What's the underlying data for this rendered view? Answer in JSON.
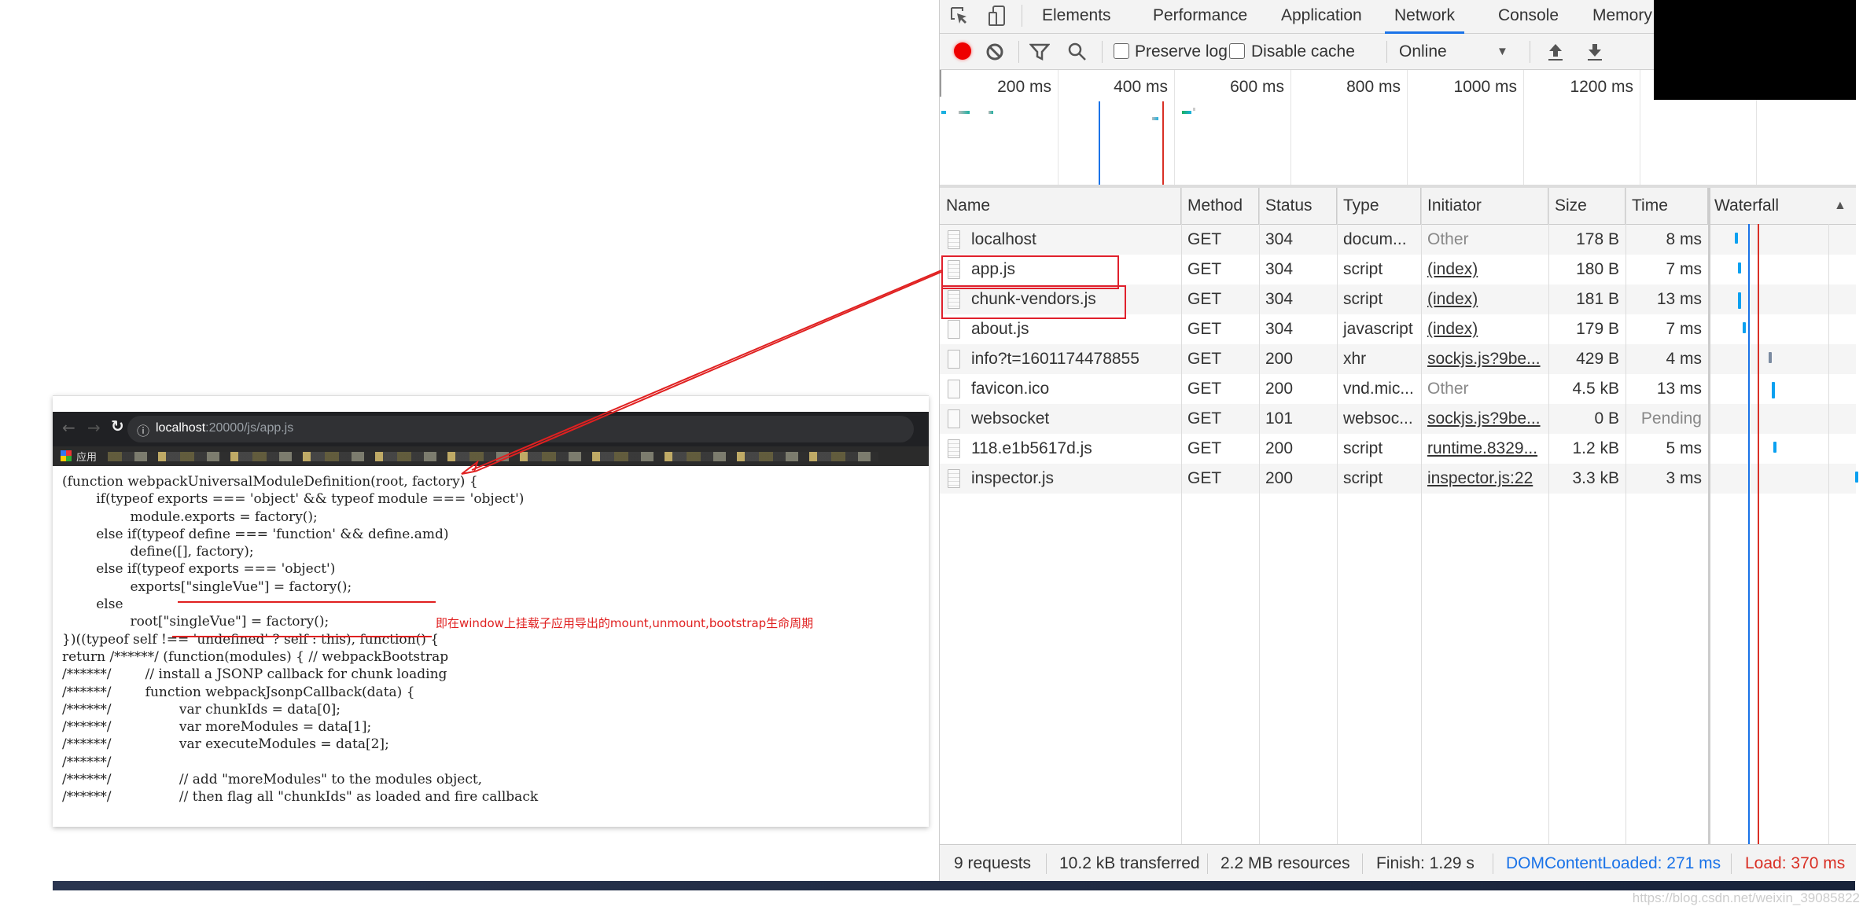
{
  "devtools": {
    "tabs": [
      "Elements",
      "Performance",
      "Application",
      "Network",
      "Console",
      "Memory"
    ],
    "active_tab": "Network",
    "toolbar": {
      "preserve_log": "Preserve log",
      "preserve_log_checked": false,
      "disable_cache": "Disable cache",
      "disable_cache_checked": false,
      "throttling": "Online"
    },
    "overview": {
      "ticks": [
        "200 ms",
        "400 ms",
        "600 ms",
        "800 ms",
        "1000 ms",
        "1200 ms"
      ],
      "domcontentloaded_ms": 271,
      "load_ms": 370
    },
    "table": {
      "headers": [
        "Name",
        "Method",
        "Status",
        "Type",
        "Initiator",
        "Size",
        "Time",
        "Waterfall"
      ],
      "rows": [
        {
          "name": "localhost",
          "method": "GET",
          "status": "304",
          "type": "docum...",
          "initiator": "Other",
          "size": "178 B",
          "time": "8 ms"
        },
        {
          "name": "app.js",
          "method": "GET",
          "status": "304",
          "type": "script",
          "initiator": "(index)",
          "size": "180 B",
          "time": "7 ms"
        },
        {
          "name": "chunk-vendors.js",
          "method": "GET",
          "status": "304",
          "type": "script",
          "initiator": "(index)",
          "size": "181 B",
          "time": "13 ms"
        },
        {
          "name": "about.js",
          "method": "GET",
          "status": "304",
          "type": "javascript",
          "initiator": "(index)",
          "size": "179 B",
          "time": "7 ms"
        },
        {
          "name": "info?t=1601174478855",
          "method": "GET",
          "status": "200",
          "type": "xhr",
          "initiator": "sockjs.js?9be...",
          "size": "429 B",
          "time": "4 ms"
        },
        {
          "name": "favicon.ico",
          "method": "GET",
          "status": "200",
          "type": "vnd.mic...",
          "initiator": "Other",
          "size": "4.5 kB",
          "time": "13 ms"
        },
        {
          "name": "websocket",
          "method": "GET",
          "status": "101",
          "type": "websoc...",
          "initiator": "sockjs.js?9be...",
          "size": "0 B",
          "time": "Pending"
        },
        {
          "name": "118.e1b5617d.js",
          "method": "GET",
          "status": "200",
          "type": "script",
          "initiator": "runtime.8329...",
          "size": "1.2 kB",
          "time": "5 ms"
        },
        {
          "name": "inspector.js",
          "method": "GET",
          "status": "200",
          "type": "script",
          "initiator": "inspector.js:22",
          "size": "3.3 kB",
          "time": "3 ms"
        }
      ]
    },
    "footer": {
      "requests": "9 requests",
      "transferred": "10.2 kB transferred",
      "resources": "2.2 MB resources",
      "finish": "Finish: 1.29 s",
      "dcl": "DOMContentLoaded: 271 ms",
      "load": "Load: 370 ms"
    },
    "colors": {
      "dcl": "#1a73e8",
      "load": "#d93025",
      "accent": "#1a73e8",
      "record": "#e00000"
    }
  },
  "browser": {
    "url_host": "localhost",
    "url_rest": ":20000/js/app.js",
    "bookmarks_label": "应用",
    "code_lines": [
      "(function webpackUniversalModuleDefinition(root, factory) {",
      "        if(typeof exports === 'object' && typeof module === 'object')",
      "                module.exports = factory();",
      "        else if(typeof define === 'function' && define.amd)",
      "                define([], factory);",
      "        else if(typeof exports === 'object')",
      "                exports[\"singleVue\"] = factory();",
      "        else",
      "                root[\"singleVue\"] = factory();",
      "})((typeof self !== 'undefined' ? self : this), function() {",
      "return /******/ (function(modules) { // webpackBootstrap",
      "/******/        // install a JSONP callback for chunk loading",
      "/******/        function webpackJsonpCallback(data) {",
      "/******/                var chunkIds = data[0];",
      "/******/                var moreModules = data[1];",
      "/******/                var executeModules = data[2];",
      "/******/",
      "/******/                // add \"moreModules\" to the modules object,",
      "/******/                // then flag all \"chunkIds\" as loaded and fire callback"
    ],
    "annotation": "即在window上挂载子应用导出的mount,unmount,bootstrap生命周期"
  },
  "watermark": "https://blog.csdn.net/weixin_39085822"
}
